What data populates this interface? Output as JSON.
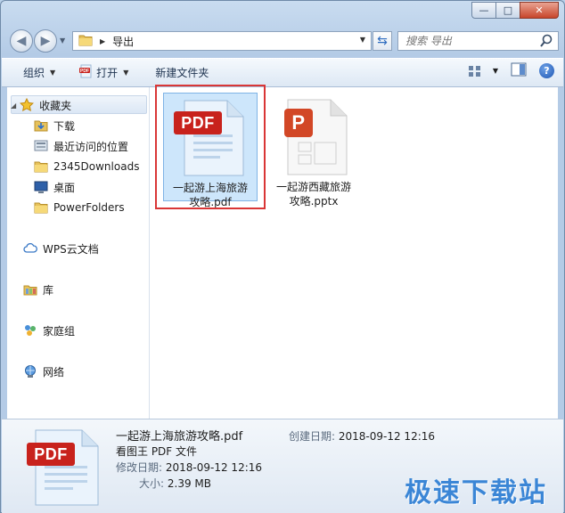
{
  "window": {
    "caption_buttons": {
      "minimize": "—",
      "maximize": "□",
      "close": "✕"
    }
  },
  "address_bar": {
    "breadcrumb": [
      "导出"
    ]
  },
  "search": {
    "placeholder": "搜索 导出"
  },
  "toolbar": {
    "organize_label": "组织",
    "open_label": "打开",
    "new_folder_label": "新建文件夹"
  },
  "nav_pane": {
    "favorites_label": "收藏夹",
    "favorites": [
      {
        "label": "下载",
        "icon": "download-folder-icon"
      },
      {
        "label": "最近访问的位置",
        "icon": "recent-places-icon"
      },
      {
        "label": "2345Downloads",
        "icon": "folder-icon"
      },
      {
        "label": "桌面",
        "icon": "desktop-icon"
      },
      {
        "label": "PowerFolders",
        "icon": "folder-icon"
      }
    ],
    "wps_cloud_label": "WPS云文档",
    "library_label": "库",
    "homegroup_label": "家庭组",
    "network_label": "网络"
  },
  "files": [
    {
      "name_line1": "一起游上海旅游",
      "name_line2": "攻略.pdf",
      "type": "pdf",
      "selected": true,
      "badge": "PDF"
    },
    {
      "name_line1": "一起游西藏旅游",
      "name_line2": "攻略.pptx",
      "type": "pptx",
      "selected": false,
      "badge": "P"
    }
  ],
  "details": {
    "filename": "一起游上海旅游攻略.pdf",
    "filetype": "看图王 PDF 文件",
    "modified_label": "修改日期:",
    "modified_value": "2018-09-12 12:16",
    "size_label": "大小:",
    "size_value": "2.39 MB",
    "created_label": "创建日期:",
    "created_value": "2018-09-12 12:16",
    "badge": "PDF"
  },
  "watermark": "极速下载站",
  "colors": {
    "pdf_red": "#c8221c",
    "pptx_orange": "#d24726",
    "selection_outline": "#d93636",
    "watermark_blue": "#3b86d6"
  }
}
